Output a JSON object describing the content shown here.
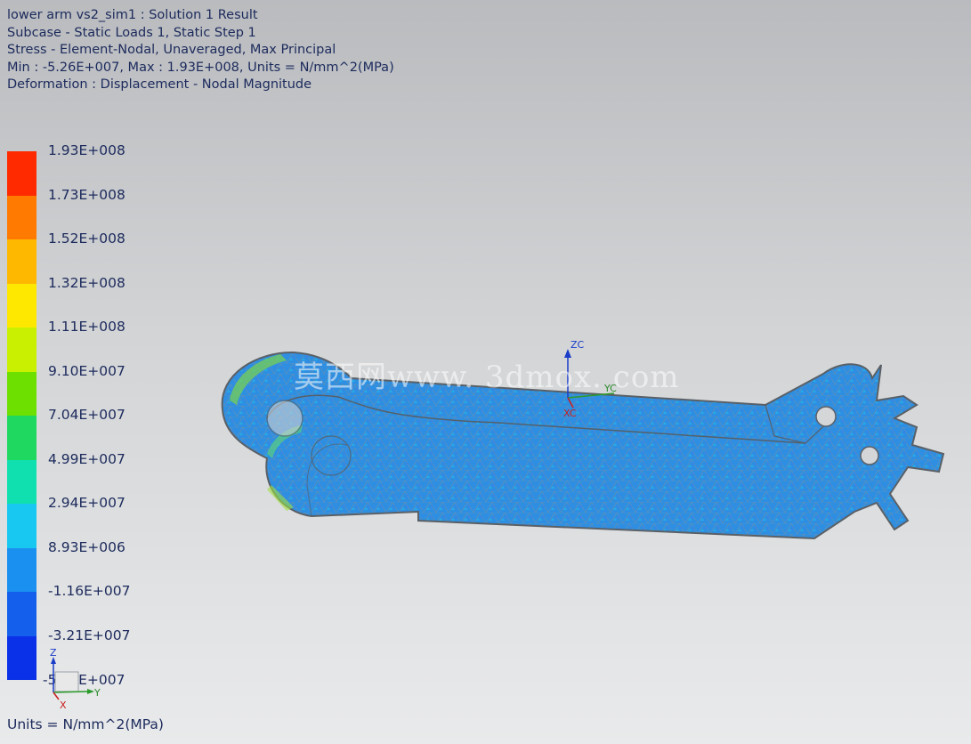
{
  "header": {
    "line1": "lower arm vs2_sim1 : Solution 1 Result",
    "line2": "Subcase - Static Loads 1, Static Step 1",
    "line3": "Stress - Element-Nodal, Unaveraged, Max Principal",
    "line4": "Min : -5.26E+007, Max : 1.93E+008, Units = N/mm^2(MPa)",
    "line5": "Deformation : Displacement - Nodal Magnitude"
  },
  "legend": {
    "labels": [
      "1.93E+008",
      "1.73E+008",
      "1.52E+008",
      "1.32E+008",
      "1.11E+008",
      "9.10E+007",
      "7.04E+007",
      "4.99E+007",
      "2.94E+007",
      "8.93E+006",
      "-1.16E+007",
      "-3.21E+007",
      "-5.26E+007"
    ],
    "colors": [
      "#ff2a00",
      "#ff7a00",
      "#ffb800",
      "#ffe800",
      "#c8f000",
      "#6ee000",
      "#1ed860",
      "#10e0b0",
      "#18c8f0",
      "#1a90f0",
      "#1460ec",
      "#0a30e8"
    ]
  },
  "units_footer": "Units = N/mm^2(MPa)",
  "triad": {
    "zc": "ZC",
    "yc": "YC",
    "xc": "XC"
  },
  "mini_triad": {
    "z": "Z",
    "y": "Y",
    "x": "X"
  },
  "watermark": "莫西网www. 3dmox. com",
  "model": {
    "name": "lower arm",
    "mesh_color": "#2f8fe0",
    "outline_color": "#5a6066"
  }
}
